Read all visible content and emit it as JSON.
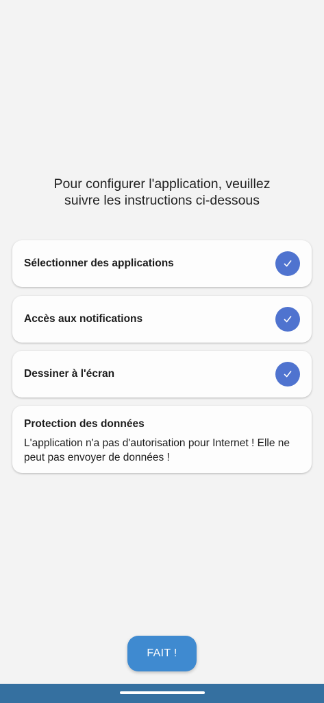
{
  "intro": {
    "line1": "Pour configurer l'application, veuillez",
    "line2": "suivre les instructions ci-dessous"
  },
  "steps": [
    {
      "label": "Sélectionner des applications",
      "status_icon": "check-icon"
    },
    {
      "label": "Accès aux notifications",
      "status_icon": "check-icon"
    },
    {
      "label": "Dessiner à l'écran",
      "status_icon": "check-icon"
    }
  ],
  "privacy": {
    "title": "Protection des données",
    "body_line1": "L'application n'a pas d'autorisation pour Internet ! Elle ne",
    "body_line2": "peut pas envoyer de données !"
  },
  "done_button": {
    "label": "FAIT !"
  },
  "colors": {
    "background": "#f3f3f3",
    "check_circle": "#4f73cf",
    "button": "#3f8ad0",
    "navbar": "#3570a0"
  }
}
